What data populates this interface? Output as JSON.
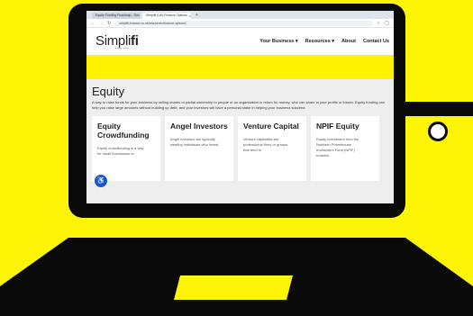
{
  "browser": {
    "tabs": [
      {
        "label": "Equity Funding Roadmap - Sim",
        "active": false
      },
      {
        "label": "Simplifi (UK) Finance Options",
        "active": true
      }
    ],
    "new_tab_icon": "plus",
    "url": "simplifi-finance.co.uk/resources/finance-options/"
  },
  "site": {
    "logo_prefix": "Simpli",
    "logo_suffix": "fi",
    "logo_tagline": "business finance",
    "nav": [
      "Your Business ▾",
      "Resources ▾",
      "About",
      "Contact Us"
    ]
  },
  "page": {
    "title": "Equity",
    "intro": "A way to raise funds for your business by selling shares or partial ownership to people or an organisation in return for money, who can share in your profits or losses. Equity funding can help you raise large amounts without building up debt, and your investors will have a personal stake in helping your business succeed.",
    "cards": [
      {
        "title": "Equity Crowdfunding",
        "text": "Equity crowdfunding is a way for small businesses to"
      },
      {
        "title": "Angel Investors",
        "text": "Angel investors are typically wealthy individuals who invest"
      },
      {
        "title": "Venture Capital",
        "text": "Venture capitalists are professional firms or groups that tend to"
      },
      {
        "title": "NPIF Equity",
        "text": "Equity investment from the Northern Powerhouse Investment Fund (NPIF) enables"
      }
    ]
  },
  "colors": {
    "background": "#fdf505",
    "laptop": "#0a0a0a",
    "accent_band": "#fff200",
    "accessibility": "#1a56c9"
  }
}
